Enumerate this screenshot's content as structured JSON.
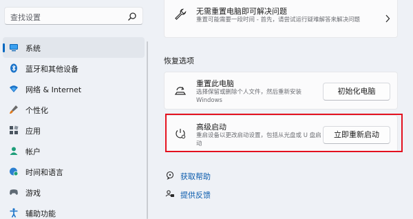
{
  "sidebar": {
    "search_placeholder": "查找设置",
    "items": [
      {
        "label": "系统",
        "icon": "monitor-icon",
        "active": true
      },
      {
        "label": "蓝牙和其他设备",
        "icon": "bluetooth-icon"
      },
      {
        "label": "网络 & Internet",
        "icon": "wifi-icon"
      },
      {
        "label": "个性化",
        "icon": "brush-icon"
      },
      {
        "label": "应用",
        "icon": "apps-icon"
      },
      {
        "label": "帐户",
        "icon": "account-icon"
      },
      {
        "label": "时间和语言",
        "icon": "globe-clock-icon"
      },
      {
        "label": "游戏",
        "icon": "gamepad-icon"
      },
      {
        "label": "辅助功能",
        "icon": "accessibility-icon"
      }
    ]
  },
  "main": {
    "troubleshoot": {
      "title": "无需重置电脑即可解决问题",
      "desc": "重置可能需要一段时间 - 首先，请尝试运行疑难解答来解决问题"
    },
    "section_title": "恢复选项",
    "reset": {
      "title": "重置此电脑",
      "desc": "选择保留或删除个人文件，然后重新安装 Windows",
      "button": "初始化电脑"
    },
    "advanced": {
      "title": "高级启动",
      "desc": "重启设备以更改启动设置，包括从光盘或 U 盘启动",
      "button": "立即重新启动"
    },
    "links": [
      {
        "label": "获取帮助",
        "icon": "help-icon"
      },
      {
        "label": "提供反馈",
        "icon": "feedback-icon"
      }
    ]
  },
  "colors": {
    "accent": "#0067c0",
    "highlight_border": "#e3101e",
    "link": "#0b5cad"
  }
}
